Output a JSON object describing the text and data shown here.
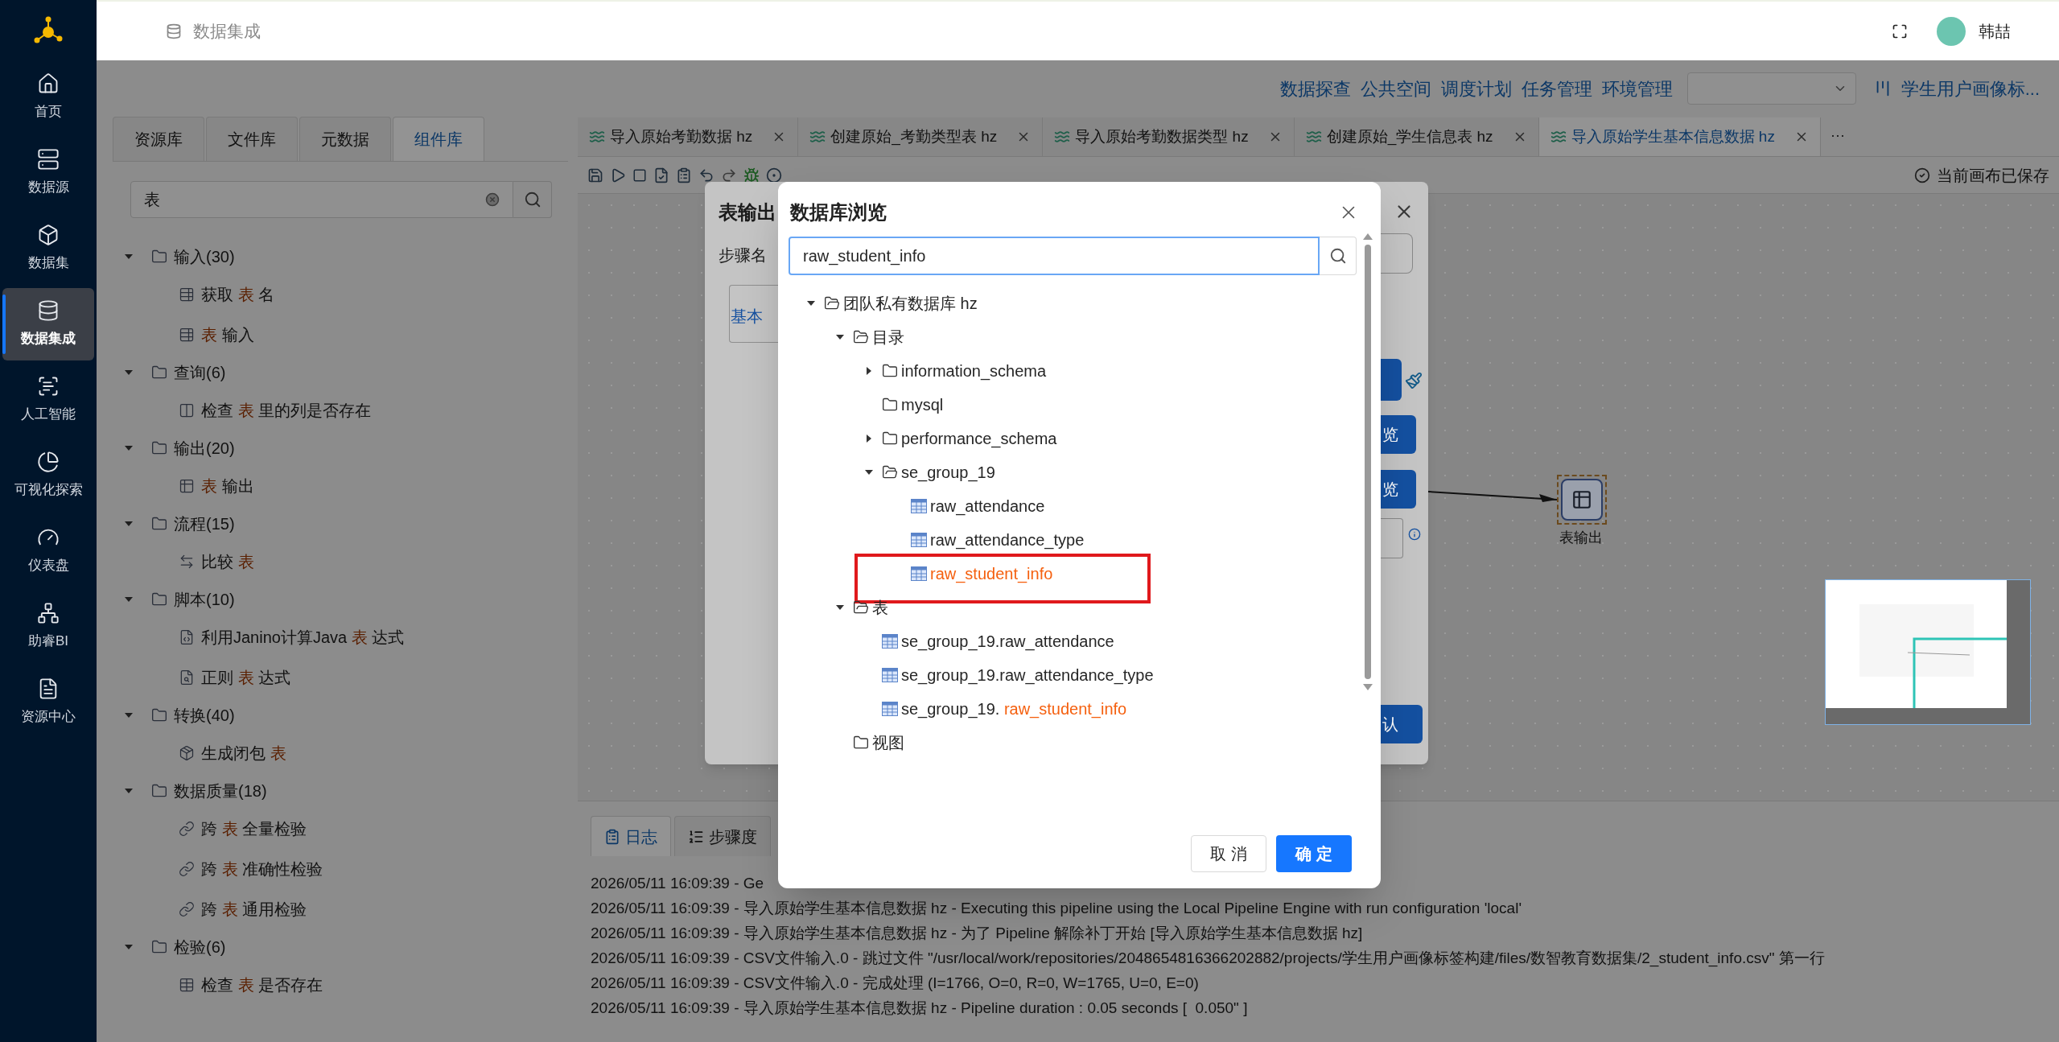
{
  "header": {
    "breadcrumb": "数据集成",
    "user": "韩喆"
  },
  "nav": [
    {
      "label": "首页",
      "selected": false
    },
    {
      "label": "数据源",
      "selected": false
    },
    {
      "label": "数据集",
      "selected": false
    },
    {
      "label": "数据集成",
      "selected": true
    },
    {
      "label": "人工智能",
      "selected": false
    },
    {
      "label": "可视化探索",
      "selected": false
    },
    {
      "label": "仪表盘",
      "selected": false
    },
    {
      "label": "助睿BI",
      "selected": false
    },
    {
      "label": "资源中心",
      "selected": false
    }
  ],
  "top_links": [
    "数据探查",
    "公共空间",
    "调度计划",
    "任务管理",
    "环境管理"
  ],
  "project": "学生用户画像标...",
  "left_tabs": [
    {
      "label": "资源库",
      "selected": false
    },
    {
      "label": "文件库",
      "selected": false
    },
    {
      "label": "元数据",
      "selected": false
    },
    {
      "label": "组件库",
      "selected": true
    }
  ],
  "component_search": {
    "value": "表"
  },
  "component_tree": [
    {
      "label": "输入(30)",
      "expanded": true,
      "children": [
        {
          "kind": "table-in",
          "parts": [
            {
              "text": "获取 ",
              "match": false
            },
            {
              "text": "表",
              "match": true
            },
            {
              "text": " 名",
              "match": false
            }
          ]
        },
        {
          "kind": "table-in",
          "parts": [
            {
              "text": "表",
              "match": true
            },
            {
              "text": " 输入",
              "match": false
            }
          ]
        }
      ]
    },
    {
      "label": "查询(6)",
      "expanded": true,
      "children": [
        {
          "kind": "column-check",
          "parts": [
            {
              "text": "检查 ",
              "match": false
            },
            {
              "text": "表",
              "match": true
            },
            {
              "text": " 里的列是否存在",
              "match": false
            }
          ]
        }
      ]
    },
    {
      "label": "输出(20)",
      "expanded": true,
      "children": [
        {
          "kind": "table-out",
          "parts": [
            {
              "text": "表",
              "match": true
            },
            {
              "text": " 输出",
              "match": false
            }
          ]
        }
      ]
    },
    {
      "label": "流程(15)",
      "expanded": true,
      "children": [
        {
          "kind": "compare",
          "parts": [
            {
              "text": "比较 ",
              "match": false
            },
            {
              "text": "表",
              "match": true
            }
          ]
        }
      ]
    },
    {
      "label": "脚本(10)",
      "expanded": true,
      "children": [
        {
          "kind": "script",
          "parts": [
            {
              "text": "利用Janino计算Java ",
              "match": false
            },
            {
              "text": "表",
              "match": true
            },
            {
              "text": " 达式",
              "match": false
            }
          ]
        },
        {
          "kind": "regex",
          "parts": [
            {
              "text": "正则 ",
              "match": false
            },
            {
              "text": "表",
              "match": true
            },
            {
              "text": " 达式",
              "match": false
            }
          ]
        }
      ]
    },
    {
      "label": "转换(40)",
      "expanded": true,
      "children": [
        {
          "kind": "closure",
          "parts": [
            {
              "text": "生成闭包 ",
              "match": false
            },
            {
              "text": "表",
              "match": true
            }
          ]
        }
      ]
    },
    {
      "label": "数据质量(18)",
      "expanded": true,
      "children": [
        {
          "kind": "link-check",
          "parts": [
            {
              "text": "跨 ",
              "match": false
            },
            {
              "text": "表",
              "match": true
            },
            {
              "text": " 全量检验",
              "match": false
            }
          ]
        },
        {
          "kind": "link-check",
          "parts": [
            {
              "text": "跨 ",
              "match": false
            },
            {
              "text": "表",
              "match": true
            },
            {
              "text": " 准确性检验",
              "match": false
            }
          ]
        },
        {
          "kind": "link-check",
          "parts": [
            {
              "text": "跨 ",
              "match": false
            },
            {
              "text": "表",
              "match": true
            },
            {
              "text": " 通用检验",
              "match": false
            }
          ]
        }
      ]
    },
    {
      "label": "检验(6)",
      "expanded": true,
      "children": [
        {
          "kind": "table",
          "parts": [
            {
              "text": "检查 ",
              "match": false
            },
            {
              "text": "表",
              "match": true
            },
            {
              "text": " 是否存在",
              "match": false
            }
          ]
        }
      ]
    }
  ],
  "file_tabs": [
    {
      "label": "导入原始考勤数据 hz",
      "selected": false
    },
    {
      "label": "创建原始_考勤类型表 hz",
      "selected": false
    },
    {
      "label": "导入原始考勤数据类型 hz",
      "selected": false
    },
    {
      "label": "创建原始_学生信息表 hz",
      "selected": false
    },
    {
      "label": "导入原始学生基本信息数据 hz",
      "selected": true
    }
  ],
  "more_tabs": "···",
  "save_status": "当前画布已保存",
  "canvas": {
    "node_label": "表输出"
  },
  "bottom_tabs": [
    {
      "label": "日志",
      "kind": "log",
      "selected": true
    },
    {
      "label": "步骤度",
      "kind": "list",
      "selected": false
    }
  ],
  "log_lines": [
    "2026/05/11 16:09:39 - Ge",
    "2026/05/11 16:09:39 - 导入原始学生基本信息数据 hz - Executing this pipeline using the Local Pipeline Engine with run configuration 'local'",
    "2026/05/11 16:09:39 - 导入原始学生基本信息数据 hz - 为了 Pipeline 解除补丁开始 [导入原始学生基本信息数据 hz]",
    "2026/05/11 16:09:39 - CSV文件输入.0 - 跳过文件 \"/usr/local/work/repositories/2048654816366202882/projects/学生用户画像标签构建/files/数智教育数据集/2_student_info.csv\" 第一行",
    "2026/05/11 16:09:39 - CSV文件输入.0 - 完成处理 (I=1766, O=0, R=0, W=1765, U=0, E=0)",
    "2026/05/11 16:09:39 - 导入原始学生基本信息数据 hz - Pipeline duration : 0.05 seconds [  0.050\" ]"
  ],
  "step_dialog": {
    "title": "表输出",
    "field_label": "步骤名",
    "tab": "基本",
    "button_fragments": [
      "览",
      "览",
      "认"
    ]
  },
  "browse_dialog": {
    "title": "数据库浏览",
    "search": {
      "value": "raw_student_info"
    },
    "tree": [
      {
        "kind": "group",
        "label": "团队私有数据库 hz",
        "expanded": true,
        "children": [
          {
            "kind": "group",
            "label": "目录",
            "expanded": true,
            "children": [
              {
                "kind": "group",
                "label": "information_schema",
                "expanded": false
              },
              {
                "kind": "folder",
                "label": "mysql"
              },
              {
                "kind": "group",
                "label": "performance_schema",
                "expanded": false
              },
              {
                "kind": "group",
                "label": "se_group_19",
                "expanded": true,
                "children": [
                  {
                    "kind": "table",
                    "annotated": false,
                    "parts": [
                      {
                        "text": "raw_attendance",
                        "match": false
                      }
                    ]
                  },
                  {
                    "kind": "table",
                    "annotated": false,
                    "parts": [
                      {
                        "text": "raw_attendance_type",
                        "match": false
                      }
                    ]
                  },
                  {
                    "kind": "table",
                    "annotated": true,
                    "parts": [
                      {
                        "text": "raw_student_info",
                        "match": true
                      }
                    ]
                  }
                ]
              }
            ]
          },
          {
            "kind": "group",
            "label": "表",
            "expanded": true,
            "children": [
              {
                "kind": "table",
                "annotated": false,
                "parts": [
                  {
                    "text": "se_group_19.raw_attendance",
                    "match": false
                  }
                ]
              },
              {
                "kind": "table",
                "annotated": false,
                "parts": [
                  {
                    "text": "se_group_19.raw_attendance_type",
                    "match": false
                  }
                ]
              },
              {
                "kind": "table",
                "annotated": false,
                "parts": [
                  {
                    "text": "se_group_19. ",
                    "match": false
                  },
                  {
                    "text": "raw_student_info",
                    "match": true
                  }
                ]
              }
            ]
          },
          {
            "kind": "folder",
            "label": "视图"
          }
        ]
      }
    ],
    "buttons": [
      {
        "label": "取 消",
        "kind": "default"
      },
      {
        "label": "确 定",
        "kind": "primary"
      }
    ]
  }
}
